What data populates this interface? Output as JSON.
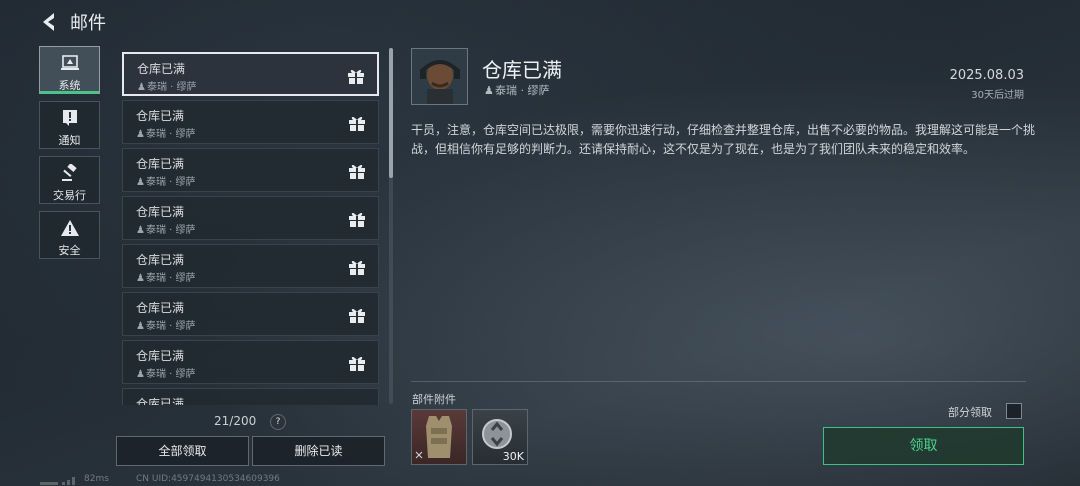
{
  "header": {
    "title": "邮件",
    "back_icon": "back-arrow-icon"
  },
  "nav": [
    {
      "label": "系统",
      "icon": "system-icon",
      "active": true
    },
    {
      "label": "通知",
      "icon": "notice-icon",
      "active": false
    },
    {
      "label": "交易行",
      "icon": "auction-gavel-icon",
      "active": false
    },
    {
      "label": "安全",
      "icon": "warning-icon",
      "active": false
    }
  ],
  "mail_list": [
    {
      "title": "仓库已满",
      "sender": "泰瑞 · 缪萨"
    },
    {
      "title": "仓库已满",
      "sender": "泰瑞 · 缪萨"
    },
    {
      "title": "仓库已满",
      "sender": "泰瑞 · 缪萨"
    },
    {
      "title": "仓库已满",
      "sender": "泰瑞 · 缪萨"
    },
    {
      "title": "仓库已满",
      "sender": "泰瑞 · 缪萨"
    },
    {
      "title": "仓库已满",
      "sender": "泰瑞 · 缪萨"
    },
    {
      "title": "仓库已满",
      "sender": "泰瑞 · 缪萨"
    },
    {
      "title": "仓库已满",
      "sender": ""
    }
  ],
  "list_footer": {
    "count": "21/200",
    "help": "?",
    "claim_all": "全部领取",
    "delete_read": "删除已读"
  },
  "status": {
    "ping": "82ms",
    "uid": "CN UID:4597494130534609396"
  },
  "detail": {
    "title": "仓库已满",
    "sender": "泰瑞 · 缪萨",
    "date": "2025.08.03",
    "expire": "30天后过期",
    "body": "干员，注意，仓库空间已达极限，需要你迅速行动，仔细检查并整理仓库，出售不必要的物品。我理解这可能是一个挑战，但相信你有足够的判断力。还请保持耐心，这不仅是为了现在，也是为了我们团队未来的稳定和效率。",
    "attachments_label": "部件附件",
    "attachments": [
      {
        "icon": "armor-vest-icon"
      },
      {
        "icon": "coin-icon",
        "qty": "30K"
      }
    ],
    "partial_claim": "部分领取",
    "claim": "领取"
  },
  "colors": {
    "accent": "#4cc38a",
    "claim_text": "#4fd18e"
  }
}
